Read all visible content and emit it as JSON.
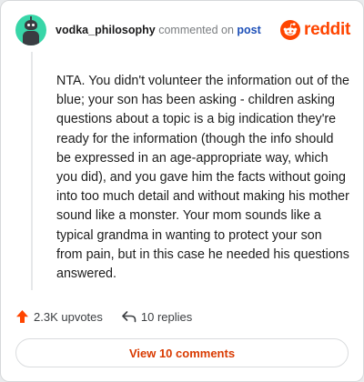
{
  "header": {
    "username": "vodka_philosophy",
    "action_text": "commented on",
    "target_link": "post",
    "brand": "reddit"
  },
  "comment": {
    "body": "NTA. You didn't volunteer the information out of the blue; your son has been asking - children asking questions about a topic is a big indication they're ready for the information (though the info should be expressed in an age-appropriate way, which you did), and you gave him the facts without going into too much detail and without making his mother sound like a monster. Your mom sounds like a typical grandma in wanting to protect your son from pain, but in this case he needed his questions answered."
  },
  "actions": {
    "upvotes": "2.3K upvotes",
    "replies": "10 replies"
  },
  "view_button": "View 10 comments",
  "colors": {
    "brand": "#ff4500",
    "link": "#1c4fb8",
    "avatar": "#38d6a8",
    "button_text": "#d93a00"
  },
  "icons": {
    "avatar": "snoo-avatar-icon",
    "brand": "reddit-logo-icon",
    "upvote": "upvote-arrow-icon",
    "reply": "reply-arrow-icon"
  }
}
